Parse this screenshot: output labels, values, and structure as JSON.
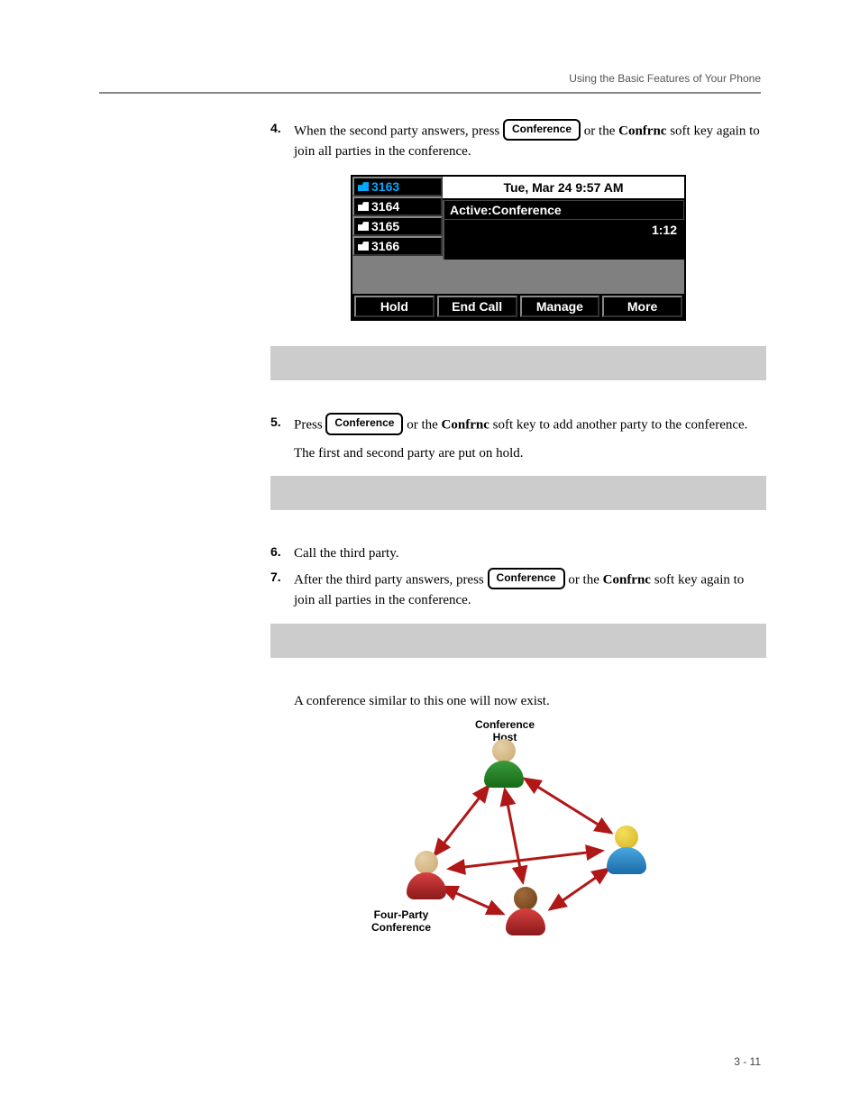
{
  "header": {
    "title": "Using the Basic Features of Your Phone"
  },
  "buttons": {
    "conference": "Conference"
  },
  "steps": {
    "s4_num": "4.",
    "s4_a": "When the second party answers, press ",
    "s4_b": " or the ",
    "s4_bold": "Confrnc",
    "s4_c": " soft key again to join all parties in the conference.",
    "s5_num": "5.",
    "s5_a": "Press ",
    "s5_b": " or the ",
    "s5_bold": "Confrnc",
    "s5_c": " soft key to add another party to the conference.",
    "s5_para": "The first and second party are put on hold.",
    "s6_num": "6.",
    "s6_text": "Call the third party.",
    "s7_num": "7.",
    "s7_a": "After the third party answers, press ",
    "s7_b": " or the ",
    "s7_bold": "Confrnc",
    "s7_c": " soft key again to join all parties in the conference.",
    "s7_para": "A conference similar to this one will now exist."
  },
  "phone": {
    "ext": [
      "3163",
      "3164",
      "3165",
      "3166"
    ],
    "titlebar": "Tue, Mar 24  9:57 AM",
    "status": "Active:Conference",
    "timer": "1:12",
    "softkeys": [
      "Hold",
      "End Call",
      "Manage",
      "More"
    ]
  },
  "diagram": {
    "host_label": "Conference\nHost",
    "title_label": "Four-Party\nConference"
  },
  "footer": {
    "page": "3 - 11"
  }
}
